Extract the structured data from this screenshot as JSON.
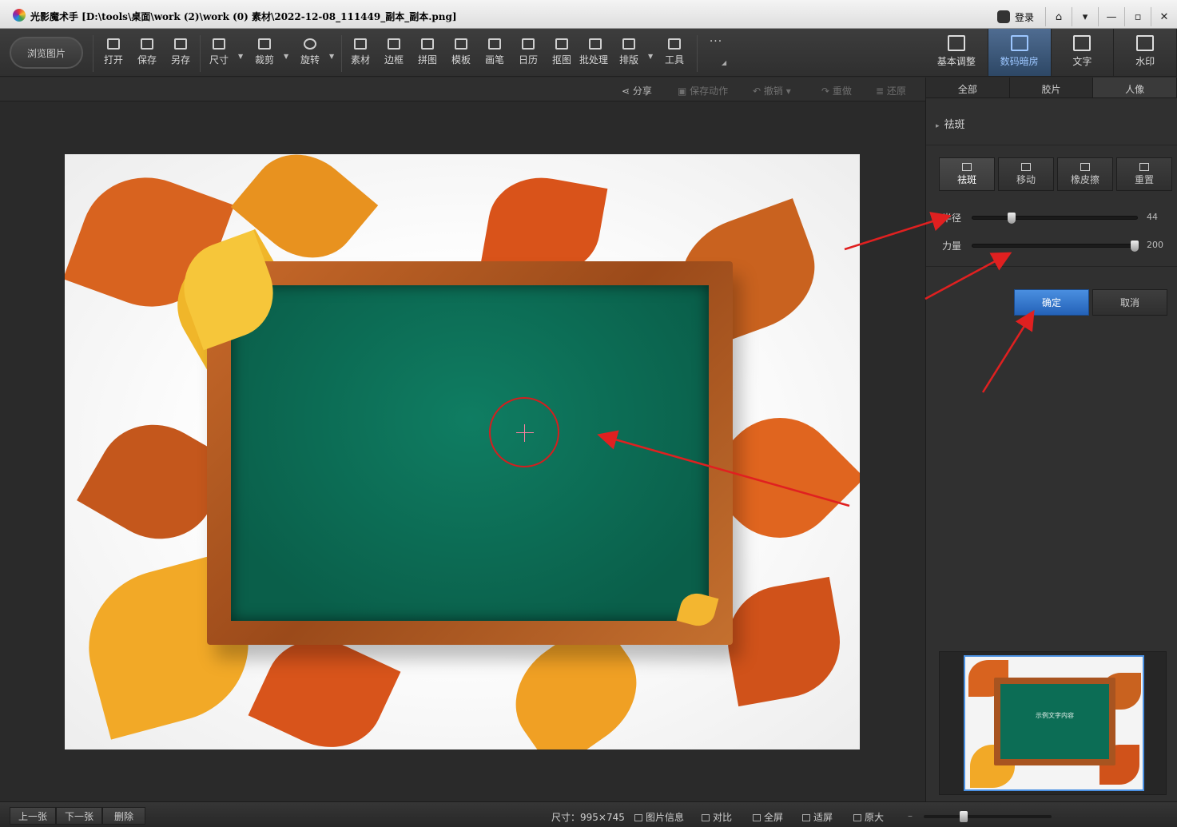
{
  "window": {
    "title": "光影魔术手  [D:\\tools\\桌面\\work (2)\\work (0) 素材\\2022-12-08_111449_副本_副本.png]",
    "login_label": "登录",
    "controls": [
      "⌂",
      "▾",
      "—",
      "▫",
      "✕"
    ]
  },
  "toolbar": {
    "browse_label": "浏览图片",
    "tools": [
      {
        "label": "打开",
        "icon": "open-icon"
      },
      {
        "label": "保存",
        "icon": "save-icon"
      },
      {
        "label": "另存",
        "icon": "save-as-icon"
      },
      {
        "label": "尺寸",
        "icon": "resize-icon"
      },
      {
        "label": "裁剪",
        "icon": "crop-icon"
      },
      {
        "label": "旋转",
        "icon": "rotate-icon"
      },
      {
        "label": "素材",
        "icon": "material-icon"
      },
      {
        "label": "边框",
        "icon": "border-icon"
      },
      {
        "label": "拼图",
        "icon": "collage-icon"
      },
      {
        "label": "模板",
        "icon": "template-icon"
      },
      {
        "label": "画笔",
        "icon": "brush-icon"
      },
      {
        "label": "日历",
        "icon": "calendar-icon"
      },
      {
        "label": "抠图",
        "icon": "cutout-icon"
      },
      {
        "label": "批处理",
        "icon": "batch-icon"
      },
      {
        "label": "排版",
        "icon": "layout-icon"
      },
      {
        "label": "工具",
        "icon": "wrench-icon"
      }
    ],
    "more_label": "···"
  },
  "right_tabs": [
    {
      "label": "基本调整",
      "icon": "basic-adjust-icon"
    },
    {
      "label": "数码暗房",
      "icon": "darkroom-icon"
    },
    {
      "label": "文字",
      "icon": "text-icon"
    },
    {
      "label": "水印",
      "icon": "watermark-icon"
    }
  ],
  "subbar": {
    "share": "分享",
    "save_action": "保存动作",
    "undo": "撤销",
    "redo": "重做",
    "restore": "还原"
  },
  "panel": {
    "subtabs": [
      "全部",
      "胶片",
      "人像"
    ],
    "section_title": "祛斑",
    "modes": [
      {
        "label": "祛斑",
        "icon": "spot-remove-icon"
      },
      {
        "label": "移动",
        "icon": "move-icon"
      },
      {
        "label": "橡皮擦",
        "icon": "eraser-icon"
      },
      {
        "label": "重置",
        "icon": "reset-icon"
      }
    ],
    "radius_label": "半径",
    "radius_value": "44",
    "radius_fraction": 0.22,
    "strength_label": "力量",
    "strength_value": "200",
    "strength_fraction": 1.0,
    "ok_label": "确定",
    "cancel_label": "取消",
    "thumbnail_text": "示例文字内容"
  },
  "bottom": {
    "prev": "上一张",
    "next": "下一张",
    "delete": "删除",
    "size_text": "尺寸：995×745",
    "info": "图片信息",
    "compare": "对比",
    "fullscreen": "全屏",
    "fit": "适屏",
    "original": "原大",
    "zoom_fraction": 0.3
  },
  "colors": {
    "accent": "#2f6fc9",
    "annotation": "#e02020"
  }
}
